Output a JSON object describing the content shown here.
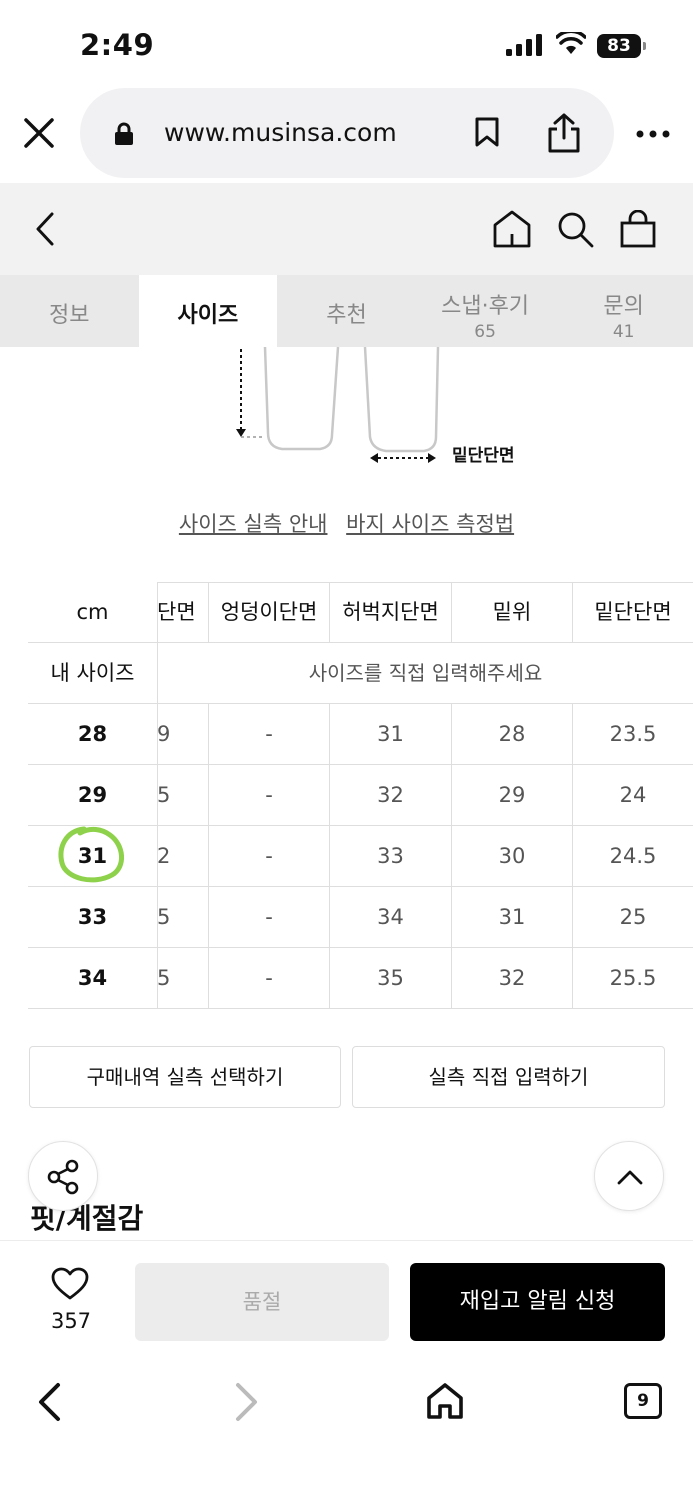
{
  "status": {
    "time": "2:49",
    "battery": "83"
  },
  "browser": {
    "url": "www.musinsa.com"
  },
  "tabs": [
    {
      "label": "정보",
      "count": ""
    },
    {
      "label": "사이즈",
      "count": ""
    },
    {
      "label": "추천",
      "count": ""
    },
    {
      "label": "스냅·후기",
      "count": "65"
    },
    {
      "label": "문의",
      "count": "41"
    }
  ],
  "diagram": {
    "hem_label": "밑단단면"
  },
  "links": {
    "size_guide": "사이즈 실측 안내",
    "pants_measure": "바지 사이즈 측정법"
  },
  "size_table": {
    "unit": "cm",
    "my_size_label": "내 사이즈",
    "my_size_placeholder": "사이즈를 직접 입력해주세요",
    "columns": [
      "단면",
      "엉덩이단면",
      "허벅지단면",
      "밑위",
      "밑단단면"
    ],
    "rows": [
      {
        "size": "28",
        "cells": [
          "9",
          "-",
          "31",
          "28",
          "23.5"
        ]
      },
      {
        "size": "29",
        "cells": [
          "5",
          "-",
          "32",
          "29",
          "24"
        ]
      },
      {
        "size": "31",
        "cells": [
          "2",
          "-",
          "33",
          "30",
          "24.5"
        ]
      },
      {
        "size": "33",
        "cells": [
          "5",
          "-",
          "34",
          "31",
          "25"
        ]
      },
      {
        "size": "34",
        "cells": [
          "5",
          "-",
          "35",
          "32",
          "25.5"
        ]
      }
    ]
  },
  "actions": {
    "select_purchase": "구매내역 실측 선택하기",
    "enter_direct": "실측 직접 입력하기"
  },
  "fit_title": "핏/계절감",
  "purchase": {
    "likes": "357",
    "sold_out": "품절",
    "restock": "재입고 알림 신청"
  },
  "bottom_nav": {
    "tab_count": "9"
  }
}
